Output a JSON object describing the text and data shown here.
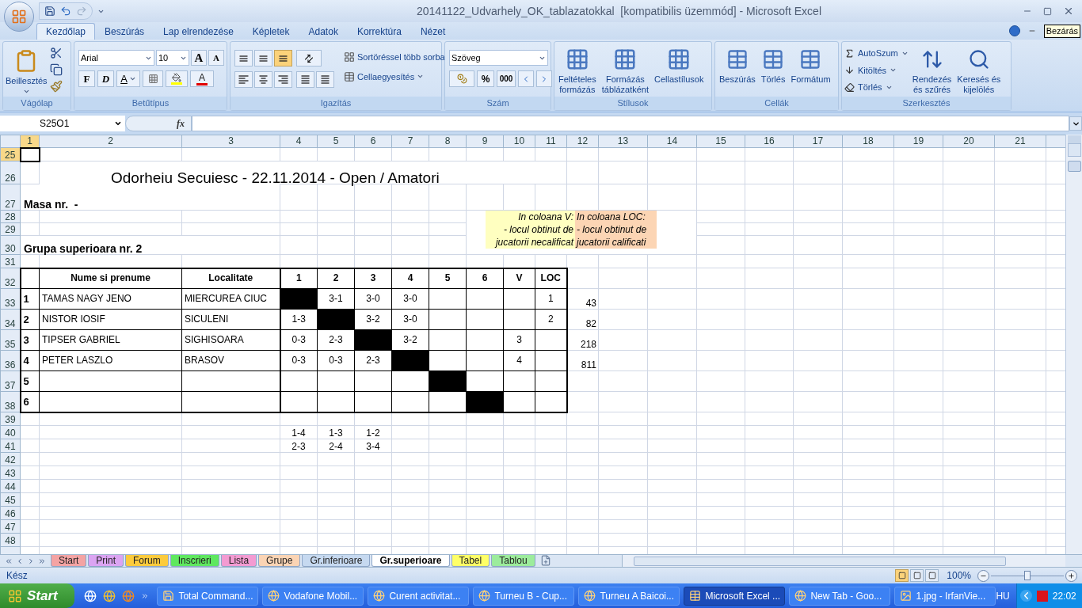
{
  "window": {
    "title": "20141122_Udvarhely_OK_tablazatokkal  [kompatibilis üzemmód] - Microsoft Excel"
  },
  "ribbon_tabs": [
    {
      "label": "Kezdőlap",
      "selected": true
    },
    {
      "label": "Beszúrás",
      "selected": false
    },
    {
      "label": "Lap elrendezése",
      "selected": false
    },
    {
      "label": "Képletek",
      "selected": false
    },
    {
      "label": "Adatok",
      "selected": false
    },
    {
      "label": "Korrektúra",
      "selected": false
    },
    {
      "label": "Nézet",
      "selected": false
    }
  ],
  "tooltip": "Bezárás",
  "ribbon": {
    "clipboard": {
      "title": "Vágólap",
      "paste": "Beillesztés"
    },
    "font": {
      "title": "Betűtípus",
      "font_name": "Arial",
      "font_size": "10",
      "grow": "A",
      "shrink": "A",
      "bold": "F",
      "italic": "D",
      "underline": "A",
      "font_color": "A"
    },
    "alignment": {
      "title": "Igazítás",
      "wrap": "Sortöréssel több sorba",
      "merge": "Cellaegyesítés",
      "vertical_buttons": [
        {
          "selected": false
        },
        {
          "selected": false
        },
        {
          "selected": true
        }
      ]
    },
    "number": {
      "title": "Szám",
      "format": "Szöveg",
      "percent": "%",
      "thousands": "000"
    },
    "styles": {
      "title": "Stílusok",
      "buttons": [
        {
          "lines": [
            "Feltételes",
            "formázás"
          ]
        },
        {
          "lines": [
            "Formázás",
            "táblázatként"
          ]
        },
        {
          "lines": [
            "Cellastílusok"
          ]
        }
      ]
    },
    "cells": {
      "title": "Cellák",
      "buttons": [
        {
          "lines": [
            "Beszúrás"
          ]
        },
        {
          "lines": [
            "Törlés"
          ]
        },
        {
          "lines": [
            "Formátum"
          ]
        }
      ]
    },
    "editing": {
      "title": "Szerkesztés",
      "small_buttons": [
        "AutoSzum",
        "Kitöltés",
        "Törlés"
      ],
      "buttons": [
        {
          "lines": [
            "Rendezés",
            "és szűrés"
          ]
        },
        {
          "lines": [
            "Keresés és",
            "kijelölés"
          ]
        }
      ]
    }
  },
  "formula_bar": {
    "name_box": "S25O1",
    "fx": "fx"
  },
  "sheet": {
    "columns": [
      {
        "label": "1",
        "selected": true
      },
      {
        "label": "2",
        "selected": false
      },
      {
        "label": "3",
        "selected": false
      },
      {
        "label": "4",
        "selected": false
      },
      {
        "label": "5",
        "selected": false
      },
      {
        "label": "6",
        "selected": false
      },
      {
        "label": "7",
        "selected": false
      },
      {
        "label": "8",
        "selected": false
      },
      {
        "label": "9",
        "selected": false
      },
      {
        "label": "10",
        "selected": false
      },
      {
        "label": "11",
        "selected": false
      },
      {
        "label": "12",
        "selected": false
      },
      {
        "label": "13",
        "selected": false
      },
      {
        "label": "14",
        "selected": false
      },
      {
        "label": "15",
        "selected": false
      },
      {
        "label": "16",
        "selected": false
      },
      {
        "label": "17",
        "selected": false
      },
      {
        "label": "18",
        "selected": false
      },
      {
        "label": "19",
        "selected": false
      },
      {
        "label": "20",
        "selected": false
      },
      {
        "label": "21",
        "selected": false
      }
    ],
    "rows": [
      {
        "label": "25",
        "selected": true
      },
      {
        "label": "26",
        "selected": false
      },
      {
        "label": "27",
        "selected": false
      },
      {
        "label": "28",
        "selected": false
      },
      {
        "label": "29",
        "selected": false
      },
      {
        "label": "30",
        "selected": false
      },
      {
        "label": "31",
        "selected": false
      },
      {
        "label": "32",
        "selected": false
      },
      {
        "label": "33",
        "selected": false
      },
      {
        "label": "34",
        "selected": false
      },
      {
        "label": "35",
        "selected": false
      },
      {
        "label": "36",
        "selected": false
      },
      {
        "label": "37",
        "selected": false
      },
      {
        "label": "38",
        "selected": false
      },
      {
        "label": "39",
        "selected": false
      },
      {
        "label": "40",
        "selected": false
      },
      {
        "label": "41",
        "selected": false
      },
      {
        "label": "42",
        "selected": false
      },
      {
        "label": "43",
        "selected": false
      },
      {
        "label": "44",
        "selected": false
      },
      {
        "label": "45",
        "selected": false
      },
      {
        "label": "46",
        "selected": false
      },
      {
        "label": "47",
        "selected": false
      },
      {
        "label": "48",
        "selected": false
      }
    ],
    "title": "Odorheiu Secuiesc - 22.11.2014 - Open / Amatori",
    "table_label": "Masa nr.  -",
    "group_label": "Grupa superioara nr. 2",
    "notes": [
      {
        "lines": [
          "In coloana V:",
          "- locul obtinut de",
          "jucatorii necalificat"
        ],
        "color": "#ffffc0"
      },
      {
        "lines": [
          "In coloana LOC:",
          "- locul obtinut de",
          "jucatorii calificati"
        ],
        "color": "#fcd5b4"
      }
    ],
    "results_header": {
      "name": "Nume si prenume",
      "town": "Localitate",
      "numbers": [
        "1",
        "2",
        "3",
        "4",
        "5",
        "6"
      ],
      "v": "V",
      "loc": "LOC"
    },
    "results_rows": [
      {
        "no": "1",
        "name": "TAMAS NAGY JENO",
        "town": "MIERCUREA CIUC",
        "scores": [
          {
            "kind": "self"
          },
          {
            "kind": "score",
            "text": "3-1"
          },
          {
            "kind": "score",
            "text": "3-0"
          },
          {
            "kind": "score",
            "text": "3-0"
          },
          {
            "kind": "empty"
          },
          {
            "kind": "empty"
          }
        ],
        "loc": "1",
        "extra": "43"
      },
      {
        "no": "2",
        "name": "NISTOR IOSIF",
        "town": "SICULENI",
        "scores": [
          {
            "kind": "score",
            "text": "1-3"
          },
          {
            "kind": "self"
          },
          {
            "kind": "score",
            "text": "3-2"
          },
          {
            "kind": "score",
            "text": "3-0"
          },
          {
            "kind": "empty"
          },
          {
            "kind": "empty"
          }
        ],
        "loc": "2",
        "extra": "82"
      },
      {
        "no": "3",
        "name": "TIPSER GABRIEL",
        "town": "SIGHISOARA",
        "scores": [
          {
            "kind": "score",
            "text": "0-3"
          },
          {
            "kind": "score",
            "text": "2-3"
          },
          {
            "kind": "self"
          },
          {
            "kind": "score",
            "text": "3-2"
          },
          {
            "kind": "empty"
          },
          {
            "kind": "empty"
          }
        ],
        "v": "3",
        "extra": "218"
      },
      {
        "no": "4",
        "name": "PETER LASZLO",
        "town": "BRASOV",
        "scores": [
          {
            "kind": "score",
            "text": "0-3"
          },
          {
            "kind": "score",
            "text": "0-3"
          },
          {
            "kind": "score",
            "text": "2-3"
          },
          {
            "kind": "self"
          },
          {
            "kind": "empty"
          },
          {
            "kind": "empty"
          }
        ],
        "v": "4",
        "extra": "811"
      },
      {
        "no": "5",
        "scores": [
          {
            "kind": "empty"
          },
          {
            "kind": "empty"
          },
          {
            "kind": "empty"
          },
          {
            "kind": "empty"
          },
          {
            "kind": "self"
          },
          {
            "kind": "empty"
          }
        ]
      },
      {
        "no": "6",
        "scores": [
          {
            "kind": "empty"
          },
          {
            "kind": "empty"
          },
          {
            "kind": "empty"
          },
          {
            "kind": "empty"
          },
          {
            "kind": "empty"
          },
          {
            "kind": "self"
          }
        ]
      }
    ],
    "pairings": [
      [
        "1-4",
        "1-3",
        "1-2"
      ],
      [
        "2-3",
        "2-4",
        "3-4"
      ]
    ]
  },
  "sheet_tabs": [
    {
      "label": "Start",
      "color": "#f4a3a3",
      "selected": false
    },
    {
      "label": "Print",
      "color": "#dba4f2",
      "selected": false
    },
    {
      "label": "Forum",
      "color": "#fccb3c",
      "selected": false
    },
    {
      "label": "Inscrieri",
      "color": "#5fe85f",
      "selected": false
    },
    {
      "label": "Lista",
      "color": "#f39bd2",
      "selected": false
    },
    {
      "label": "Grupe",
      "color": "#fbd4b4",
      "selected": false
    },
    {
      "label": "Gr.inferioare",
      "color": "#c6d9f0",
      "selected": false
    },
    {
      "label": "Gr.superioare",
      "color": "#ffffff",
      "selected": true
    },
    {
      "label": "Tabel",
      "color": "#ffff66",
      "selected": false
    },
    {
      "label": "Tablou",
      "color": "#9cec9c",
      "selected": false
    }
  ],
  "status_bar": {
    "status": "Kész",
    "view_buttons": [
      {
        "selected": true
      },
      {
        "selected": false
      },
      {
        "selected": false
      }
    ],
    "zoom": "100%",
    "zoom_slider": {
      "level": 0.5
    }
  },
  "taskbar": {
    "start": "Start",
    "items": [
      {
        "label": "Total Command...",
        "selected": false
      },
      {
        "label": "Vodafone Mobil...",
        "selected": false
      },
      {
        "label": "Curent activitat...",
        "selected": false
      },
      {
        "label": "Turneu B - Cup...",
        "selected": false
      },
      {
        "label": "Turneu A Baicoi...",
        "selected": false
      },
      {
        "label": "Microsoft Excel ...",
        "selected": true
      },
      {
        "label": "New Tab - Goo...",
        "selected": false
      },
      {
        "label": "1.jpg - IrfanVie...",
        "selected": false
      }
    ],
    "language": "HU",
    "clock": "22:02"
  }
}
